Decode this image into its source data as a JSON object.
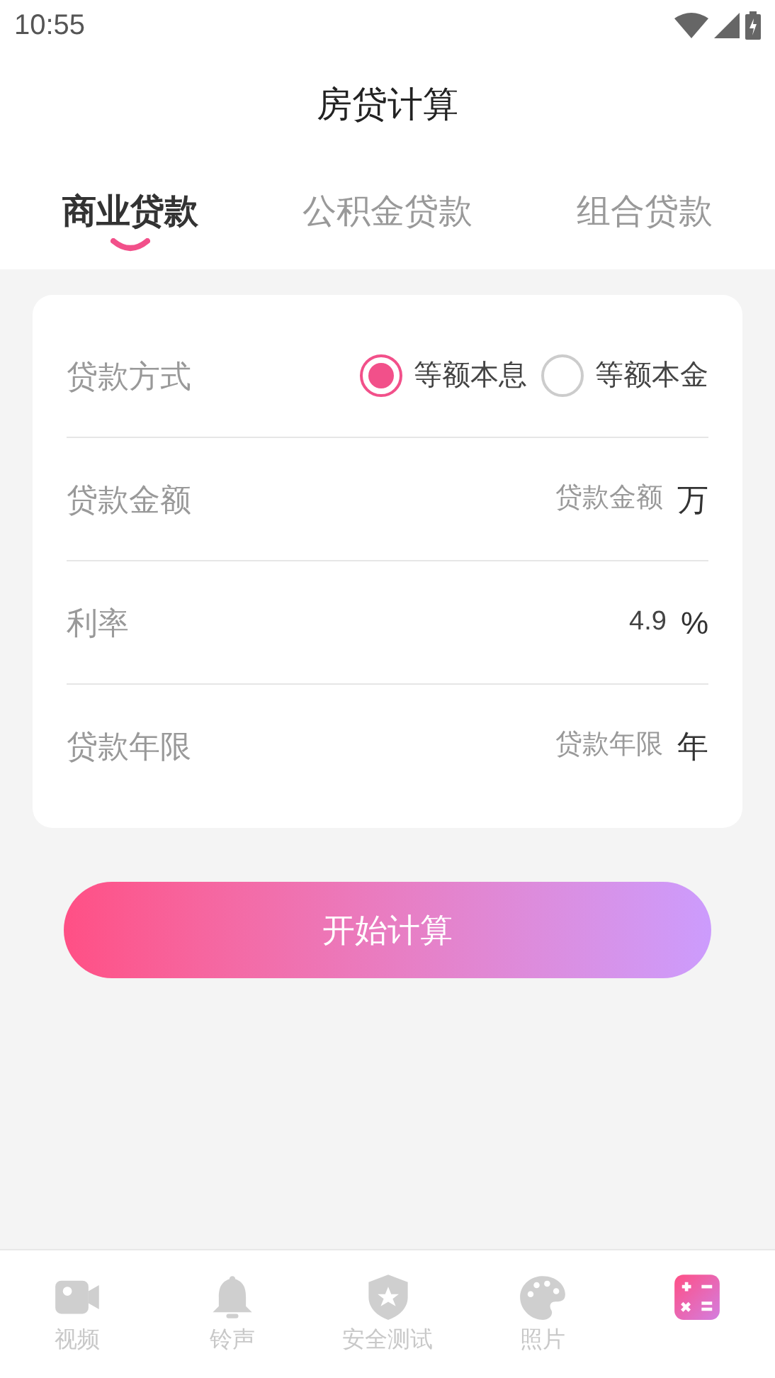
{
  "status_bar": {
    "time": "10:55"
  },
  "title": "房贷计算",
  "tabs": [
    {
      "label": "商业贷款",
      "selected": true
    },
    {
      "label": "公积金贷款",
      "selected": false
    },
    {
      "label": "组合贷款",
      "selected": false
    }
  ],
  "form": [
    {
      "kind": "radio",
      "label": "贷款方式",
      "options": [
        {
          "label": "等额本息",
          "selected": true
        },
        {
          "label": "等额本金",
          "selected": false
        }
      ]
    },
    {
      "kind": "input",
      "label": "贷款金额",
      "placeholder": "贷款金额",
      "unit": "万"
    },
    {
      "kind": "input",
      "label": "利率",
      "value": "4.9",
      "unit": "%"
    },
    {
      "kind": "input",
      "label": "贷款年限",
      "placeholder": "贷款年限",
      "unit": "年"
    }
  ],
  "button": "开始计算",
  "bottom_nav": [
    {
      "kind": "video",
      "label": "视频",
      "selected": false
    },
    {
      "kind": "bell",
      "label": "铃声",
      "selected": false
    },
    {
      "kind": "shield",
      "label": "安全测试",
      "selected": false
    },
    {
      "kind": "palette",
      "label": "照片",
      "selected": false
    },
    {
      "kind": "calculator",
      "selected": true
    }
  ]
}
